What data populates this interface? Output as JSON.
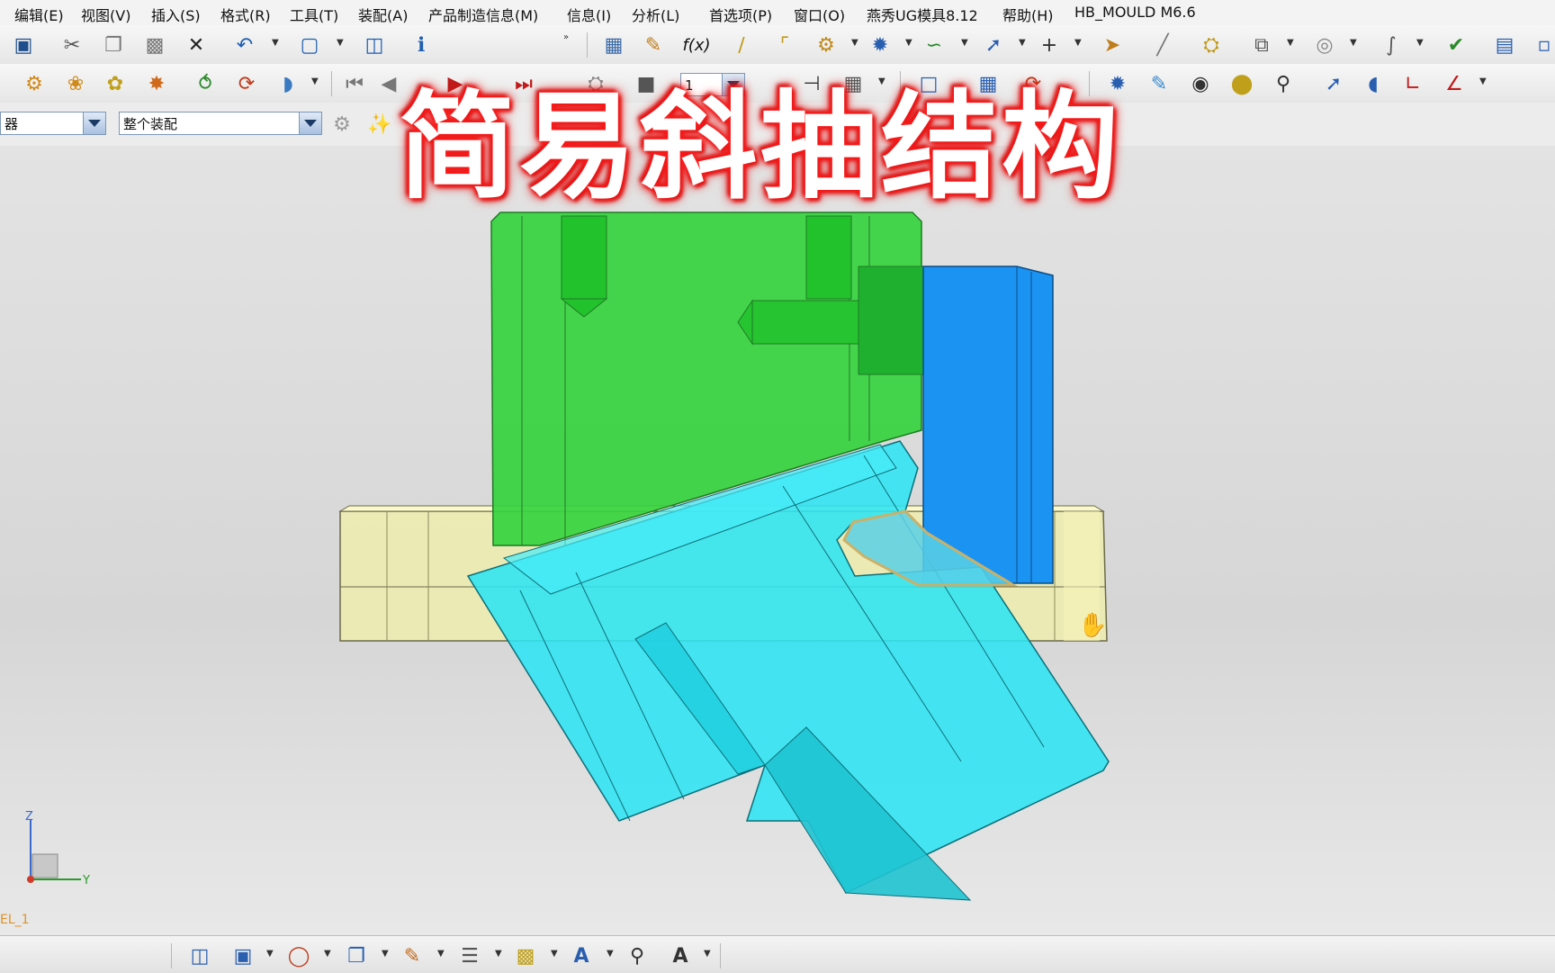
{
  "menu": [
    "编辑(E)",
    "视图(V)",
    "插入(S)",
    "格式(R)",
    "工具(T)",
    "装配(A)",
    "产品制造信息(M)",
    "信息(I)",
    "分析(L)",
    "首选项(P)",
    "窗口(O)",
    "燕秀UG模具8.12",
    "帮助(H)",
    "HB_MOULD M6.6"
  ],
  "toolbar2": {
    "frame_field_value": "1"
  },
  "selection": {
    "filter_value": "器",
    "scope_value": "整个装配"
  },
  "overlay_title": "简易斜抽结构",
  "triad": {
    "z": "Z",
    "y": "Y"
  },
  "model_label": "EL_1",
  "colors": {
    "green_part": "#3cd94a",
    "blue_part": "#1a9bf5",
    "cyan_part": "#2ee6f5",
    "yellow_plate": "#f2f0a8",
    "title_glow": "#ff2020"
  }
}
